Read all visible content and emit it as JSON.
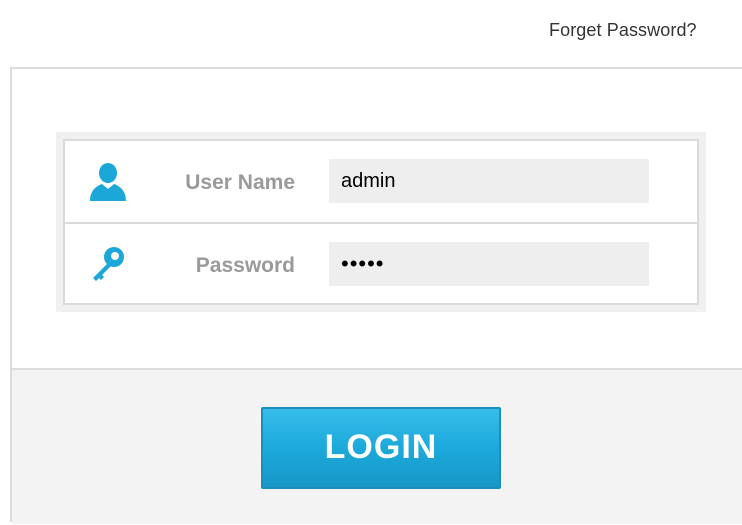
{
  "header": {
    "forget_password_link": "Forget Password?"
  },
  "login_form": {
    "username": {
      "label": "User Name",
      "value": "admin",
      "icon": "user-icon"
    },
    "password": {
      "label": "Password",
      "value": "•••••",
      "icon": "key-icon"
    },
    "login_button": "LOGIN"
  },
  "colors": {
    "icon_accent": "#1ba8d8",
    "button_top": "#37bde9",
    "button_bottom": "#1798c8",
    "label": "#9a9a9a",
    "input_bg": "#eeeeee"
  }
}
